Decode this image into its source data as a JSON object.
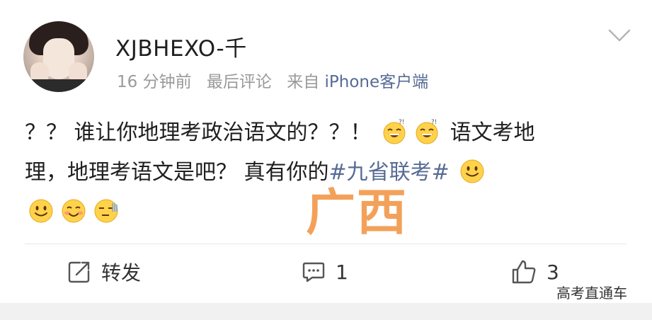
{
  "post": {
    "username": "XJBHEXO-千",
    "time": "16 分钟前",
    "status": "最后评论",
    "via": "来自",
    "source": "iPhone客户端",
    "content_line1_a": "？？ 谁让你地理考政治语文的？？！ ",
    "content_line1_b": " 语文考地",
    "content_line2_a": "理，地理考语文是吧？ 真有你的",
    "topic": "#九省联考#",
    "overlay_text": "广西",
    "emojis": [
      "dizzy-grin-emoji",
      "dizzy-grin-emoji",
      "smile-emoji",
      "smile-emoji",
      "blush-emoji",
      "awkward-emoji"
    ]
  },
  "actions": {
    "repost_label": "转发",
    "comment_count": "1",
    "like_count": "3"
  },
  "watermark": {
    "brand": "高考直通车"
  },
  "colors": {
    "link": "#576b95",
    "meta": "#9a9a9a",
    "overlay": "#f3a15a"
  }
}
